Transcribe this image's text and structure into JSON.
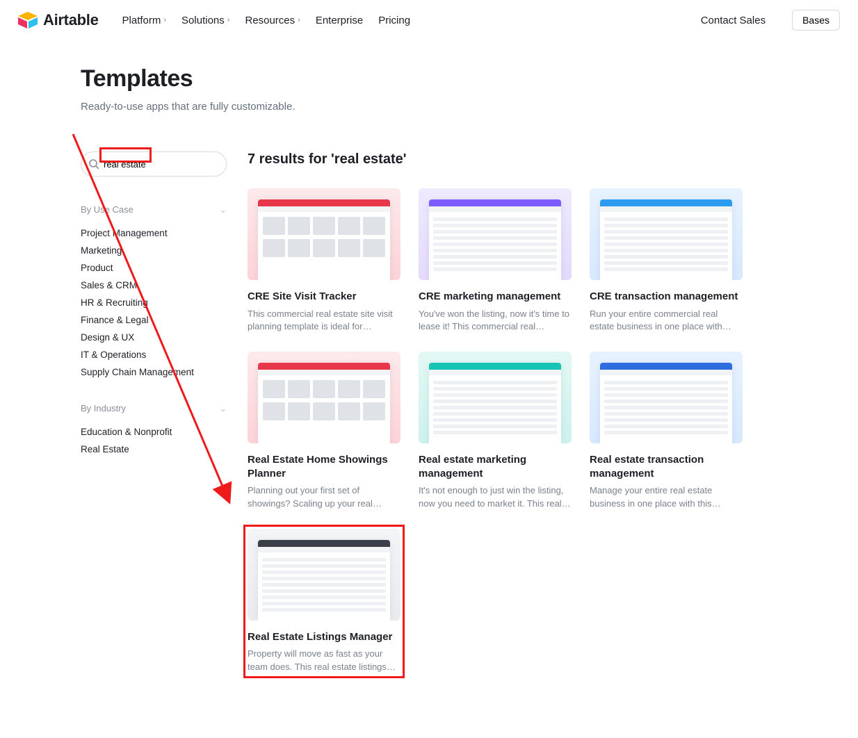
{
  "brand": "Airtable",
  "nav": {
    "platform": "Platform",
    "solutions": "Solutions",
    "resources": "Resources",
    "enterprise": "Enterprise",
    "pricing": "Pricing",
    "contact": "Contact Sales",
    "bases": "Bases"
  },
  "page": {
    "title": "Templates",
    "subtitle": "Ready-to-use apps that are fully customizable."
  },
  "search": {
    "value": "real estate"
  },
  "sidebar": {
    "useCaseHeader": "By Use Case",
    "useCase": [
      "Project Management",
      "Marketing",
      "Product",
      "Sales & CRM",
      "HR & Recruiting",
      "Finance & Legal",
      "Design & UX",
      "IT & Operations",
      "Supply Chain Management"
    ],
    "industryHeader": "By Industry",
    "industry": [
      "Education & Nonprofit",
      "Real Estate"
    ]
  },
  "results": {
    "header": "7 results for 'real estate'",
    "cards": [
      {
        "title": "CRE Site Visit Tracker",
        "desc": "This commercial real estate site visit planning template is ideal for brokers…",
        "grad": "g-red",
        "top": "t-red",
        "body": "tiles"
      },
      {
        "title": "CRE marketing management",
        "desc": "You've won the listing, now it's time to lease it! This commercial real estate…",
        "grad": "g-purple",
        "top": "t-purple",
        "body": "rows"
      },
      {
        "title": "CRE transaction management",
        "desc": "Run your entire commercial real estate business in one place with this…",
        "grad": "g-blue",
        "top": "t-blue",
        "body": "rows"
      },
      {
        "title": "Real Estate Home Showings Planner",
        "desc": "Planning out your first set of showings? Scaling up your real estat…",
        "grad": "g-red",
        "top": "t-red",
        "body": "tiles"
      },
      {
        "title": "Real estate marketing management",
        "desc": "It's not enough to just win the listing, now you need to market it. This real…",
        "grad": "g-teal",
        "top": "t-teal",
        "body": "rows"
      },
      {
        "title": "Real estate transaction management",
        "desc": "Manage your entire real estate business in one place with this…",
        "grad": "g-blue",
        "top": "t-royal",
        "body": "rows"
      },
      {
        "title": "Real Estate Listings Manager",
        "desc": "Property will move as fast as your team does. This real estate listings…",
        "grad": "g-gray",
        "top": "t-dark",
        "body": "rows",
        "highlight": true
      }
    ]
  }
}
